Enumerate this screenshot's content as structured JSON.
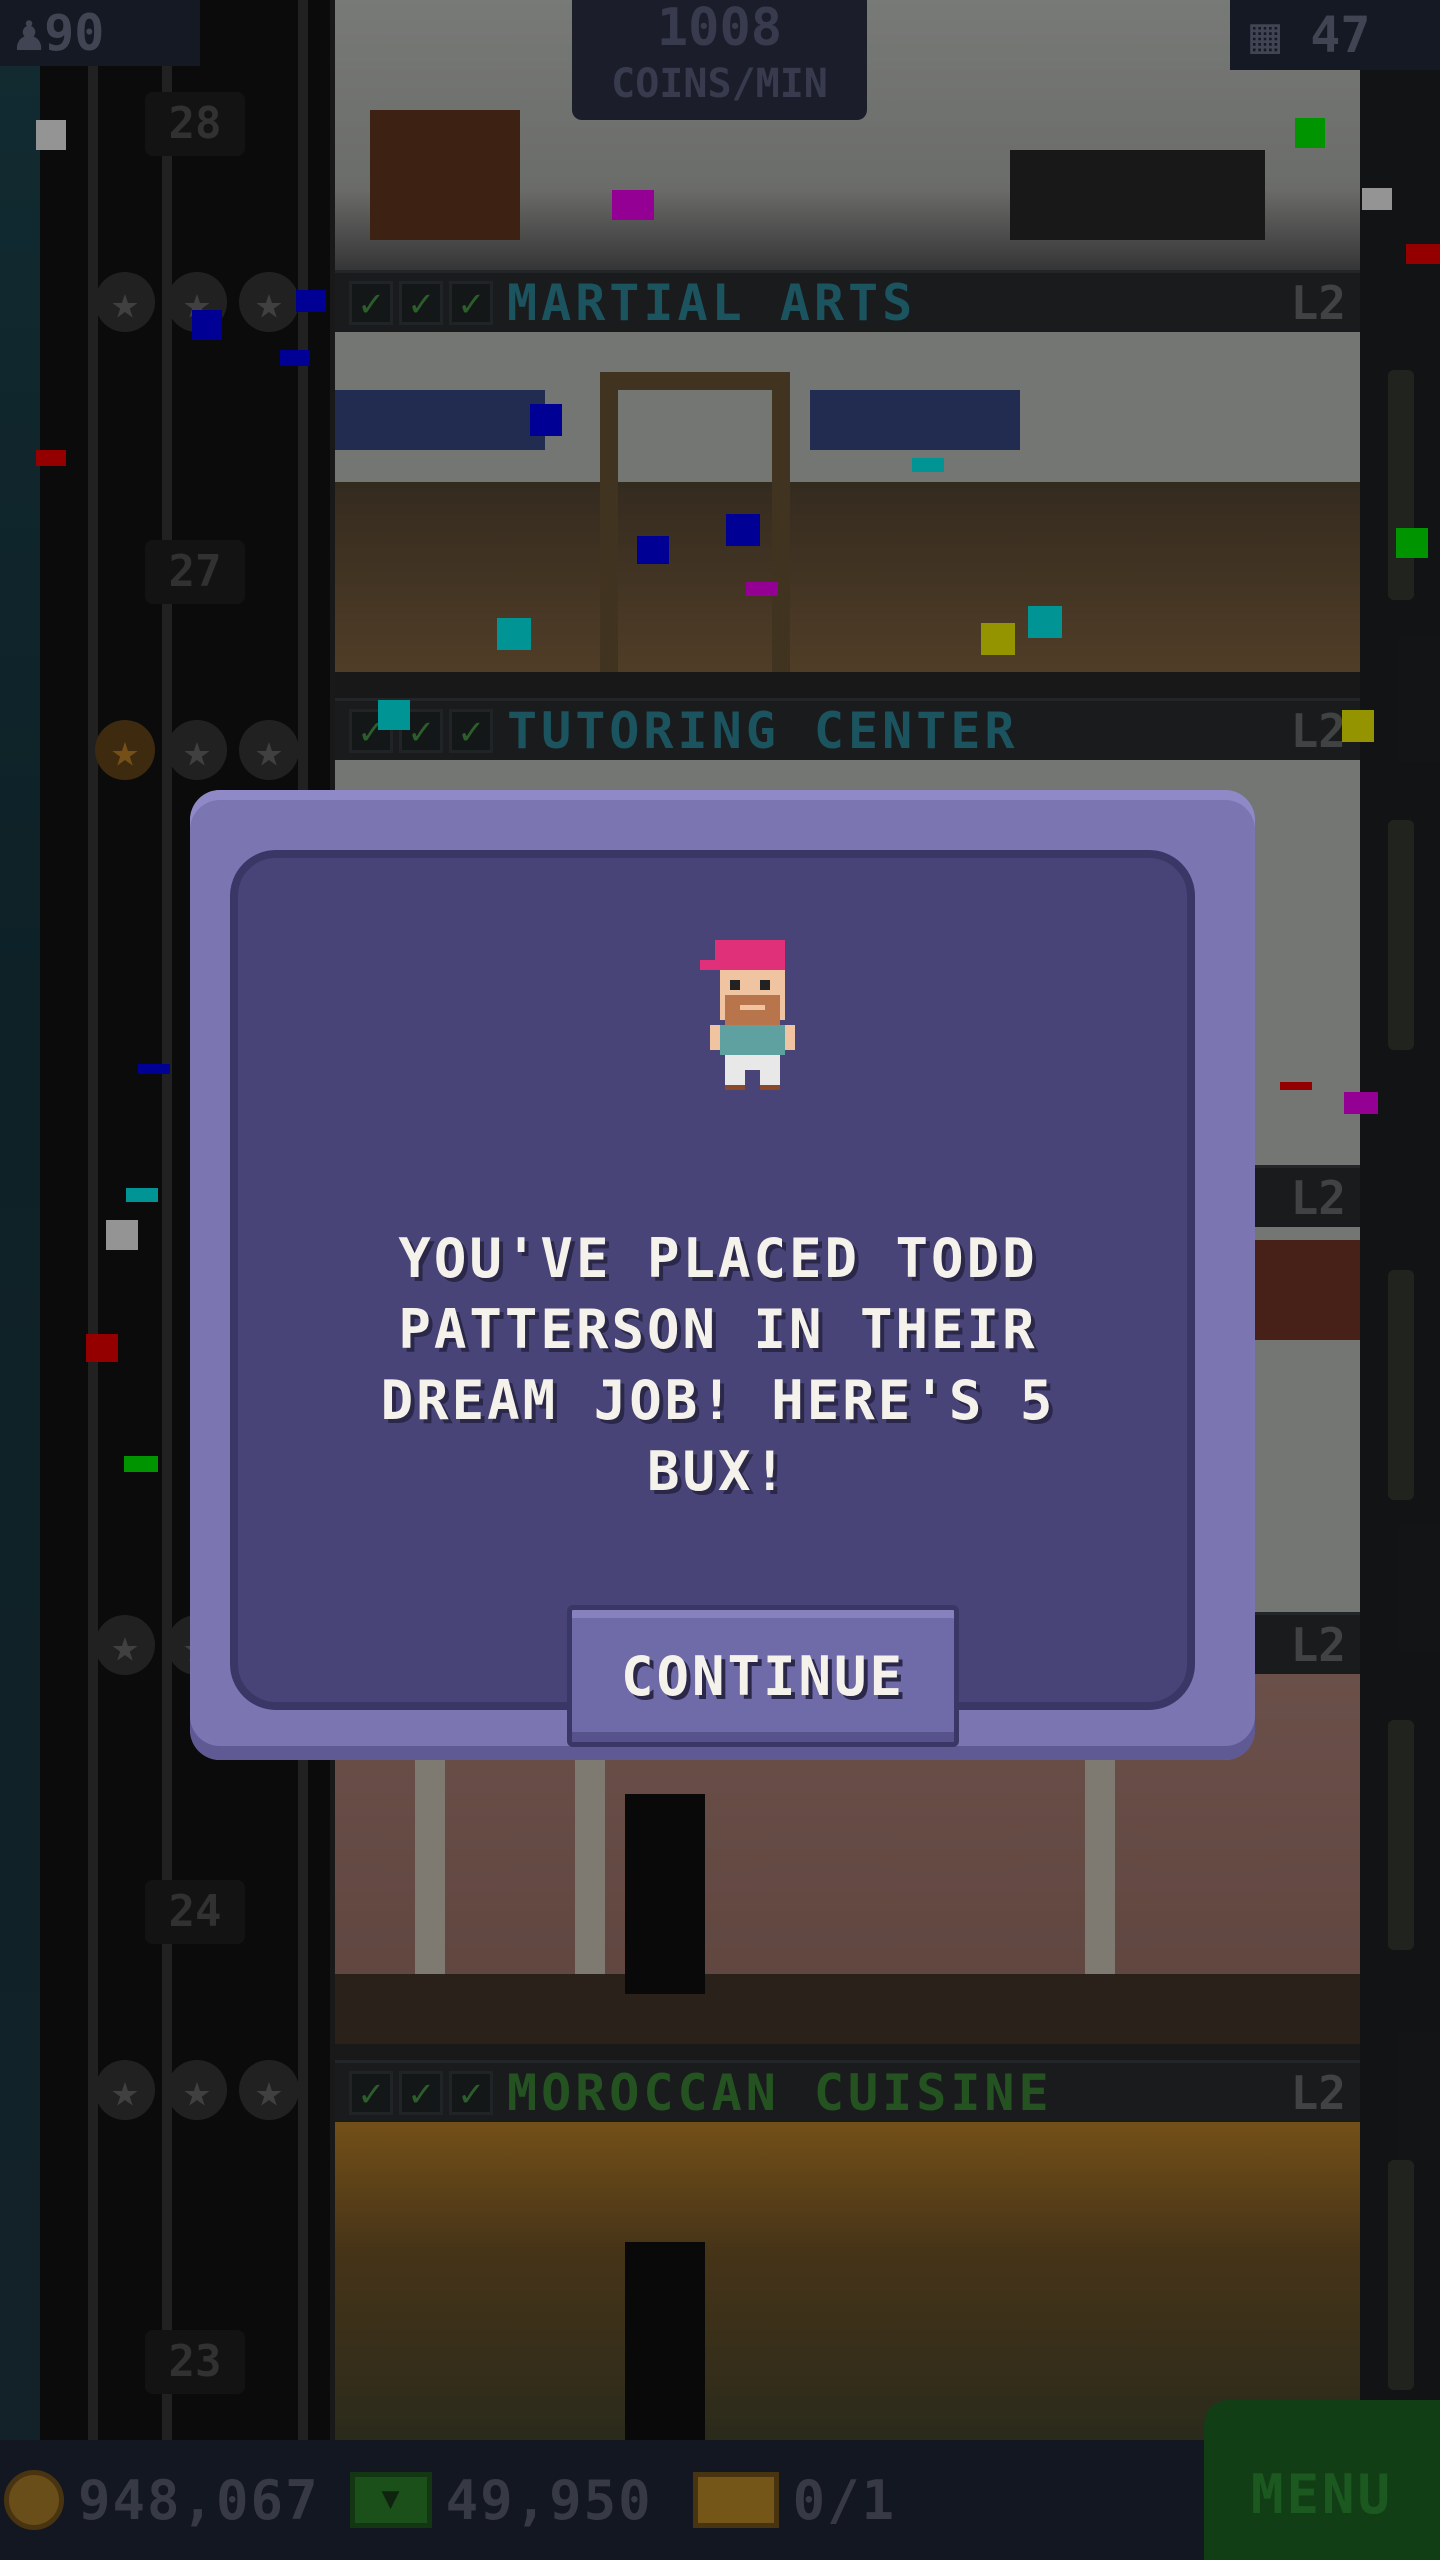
{
  "hud": {
    "population": "90",
    "coins_per_min": "1008",
    "coins_per_min_unit": "COINS/MIN",
    "floor_count": "47"
  },
  "floors": {
    "numbers": [
      "28",
      "27",
      "24",
      "23"
    ]
  },
  "rooms": [
    {
      "name": "MARTIAL ARTS",
      "level": "L2",
      "color": "#2f8fa3"
    },
    {
      "name": "TUTORING CENTER",
      "level": "L2",
      "color": "#2f8fa3"
    },
    {
      "name": "MOROCCAN CUISINE",
      "level": "L2",
      "color": "#3f8f3a"
    }
  ],
  "hidden_banner_levels": [
    "L2",
    "L2"
  ],
  "bottom_bar": {
    "coins": "948,067",
    "bux": "49,950",
    "tickets": "0/1",
    "menu_label": "MENU"
  },
  "dialog": {
    "message": "YOU'VE PLACED TODD PATTERSON IN THEIR DREAM JOB! HERE'S 5 BUX!",
    "continue_label": "CONTINUE"
  }
}
